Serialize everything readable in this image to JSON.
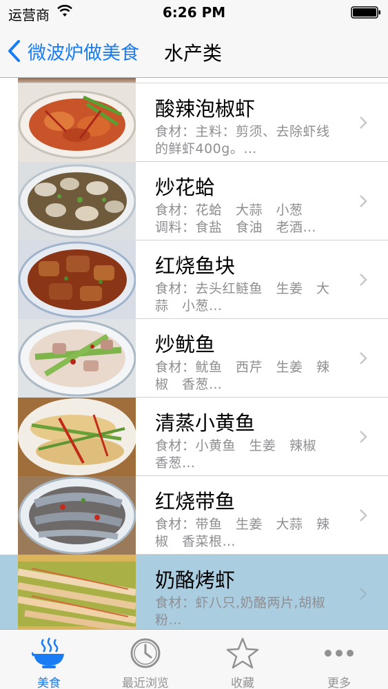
{
  "status_bar": {
    "carrier": "运营商",
    "time": "6:26 PM"
  },
  "nav": {
    "back_label": "微波炉做美食",
    "title": "水产类"
  },
  "recipes": [
    {
      "title": "酸辣泡椒虾",
      "desc_line1": "食材：主料：剪须、去除虾线",
      "desc_line2": "的鲜虾400g。…"
    },
    {
      "title": "炒花蛤",
      "desc_line1": "食材：花蛤　大蒜　小葱",
      "desc_line2": "调料：食盐　食油　老酒…"
    },
    {
      "title": "红烧鱼块",
      "desc_line1": "食材：去头红鲢鱼　生姜　大",
      "desc_line2": "蒜　小葱…"
    },
    {
      "title": "炒鱿鱼",
      "desc_line1": "食材：鱿鱼　西芹　生姜　辣",
      "desc_line2": "椒　香葱…"
    },
    {
      "title": "清蒸小黄鱼",
      "desc_line1": "食材：小黄鱼　生姜　辣椒",
      "desc_line2": "香葱…"
    },
    {
      "title": "红烧带鱼",
      "desc_line1": "食材：带鱼　生姜　大蒜　辣",
      "desc_line2": "椒　香菜根…"
    },
    {
      "title": "奶酪烤虾",
      "desc_line1": "食材：虾八只,奶酪两片,胡椒",
      "desc_line2": "粉…"
    }
  ],
  "tabs": [
    {
      "label": "美食",
      "icon": "food-bowl-icon"
    },
    {
      "label": "最近浏览",
      "icon": "clock-icon"
    },
    {
      "label": "收藏",
      "icon": "star-icon"
    },
    {
      "label": "更多",
      "icon": "more-dots-icon"
    }
  ],
  "colors": {
    "accent": "#1a7cf5",
    "selected_row": "#aacde0",
    "tab_inactive": "#929292"
  }
}
